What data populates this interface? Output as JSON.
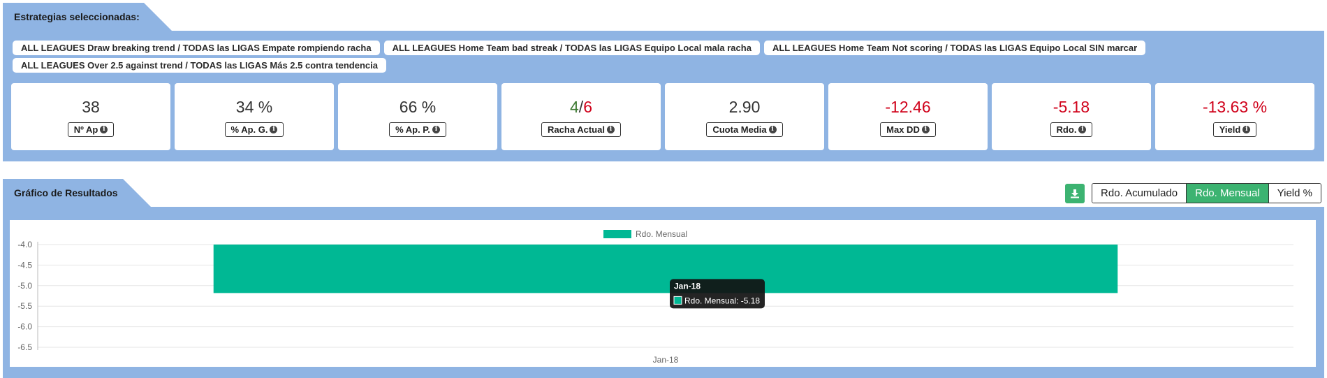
{
  "selection_header": {
    "title": "Estrategias seleccionadas:"
  },
  "strategies": [
    "ALL LEAGUES Draw breaking trend / TODAS las LIGAS Empate rompiendo racha",
    "ALL LEAGUES Home Team bad streak / TODAS las LIGAS Equipo Local mala racha",
    "ALL LEAGUES Home Team Not scoring / TODAS las LIGAS Equipo Local SIN marcar",
    "ALL LEAGUES Over 2.5 against trend / TODAS las LIGAS Más 2.5 contra tendencia"
  ],
  "stats": {
    "n_ap": {
      "value": "38",
      "label": "Nº Ap"
    },
    "pct_ap_g": {
      "value": "34 %",
      "label": "% Ap. G."
    },
    "pct_ap_p": {
      "value": "66 %",
      "label": "% Ap. P."
    },
    "racha": {
      "won": "4",
      "sep": "/",
      "lost": "6",
      "label": "Racha Actual"
    },
    "cuota": {
      "value": "2.90",
      "label": "Cuota Media"
    },
    "max_dd": {
      "value": "-12.46",
      "label": "Max DD"
    },
    "rdo": {
      "value": "-5.18",
      "label": "Rdo."
    },
    "yield": {
      "value": "-13.63 %",
      "label": "Yield"
    }
  },
  "chart_header": {
    "title": "Gráfico de Resultados"
  },
  "chart_controls": {
    "download_icon": "download-icon",
    "options": [
      "Rdo. Acumulado",
      "Rdo. Mensual",
      "Yield %"
    ],
    "active": "Rdo. Mensual"
  },
  "colors": {
    "panel": "#8fb4e3",
    "accent_green": "#3cb371",
    "bar": "#00b894",
    "negative": "#d0021b",
    "positive": "#3d7a32"
  },
  "chart_data": {
    "type": "bar",
    "categories": [
      "Jan-18"
    ],
    "series": [
      {
        "name": "Rdo. Mensual",
        "values": [
          -5.18
        ]
      }
    ],
    "ylim": [
      -6.5,
      -4.0
    ],
    "yticks": [
      -4.0,
      -4.5,
      -5.0,
      -5.5,
      -6.0,
      -6.5
    ],
    "legend": "top-center",
    "grid": true,
    "tooltip": {
      "title": "Jan-18",
      "text": "Rdo. Mensual: -5.18"
    }
  }
}
